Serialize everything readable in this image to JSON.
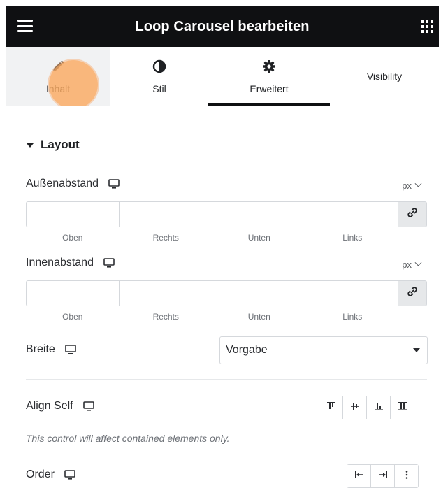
{
  "header": {
    "title": "Loop Carousel bearbeiten",
    "menu_icon": "hamburger-icon",
    "apps_icon": "grid-icon"
  },
  "tabs": [
    {
      "id": "content",
      "label": "Inhalt",
      "icon": "pencil-icon"
    },
    {
      "id": "style",
      "label": "Stil",
      "icon": "half-circle-icon"
    },
    {
      "id": "advanced",
      "label": "Erweitert",
      "icon": "gear-icon",
      "active": true
    },
    {
      "id": "visibility",
      "label": "Visibility"
    }
  ],
  "section": {
    "title": "Layout"
  },
  "margin": {
    "label": "Außenabstand",
    "unit": "px",
    "fields": [
      "",
      "",
      "",
      ""
    ],
    "sublabels": [
      "Oben",
      "Rechts",
      "Unten",
      "Links"
    ]
  },
  "padding": {
    "label": "Innenabstand",
    "unit": "px",
    "fields": [
      "",
      "",
      "",
      ""
    ],
    "sublabels": [
      "Oben",
      "Rechts",
      "Unten",
      "Links"
    ]
  },
  "width": {
    "label": "Breite",
    "value": "Vorgabe"
  },
  "align_self": {
    "label": "Align Self",
    "options": [
      "align-start-icon",
      "align-center-icon",
      "align-end-icon",
      "align-stretch-icon"
    ]
  },
  "note": "This control will affect contained elements only.",
  "order": {
    "label": "Order",
    "options": [
      "order-start-icon",
      "order-end-icon",
      "more-icon"
    ]
  },
  "colors": {
    "header_bg": "#0f1012",
    "active_tab_bg": "#f1f2f3",
    "touch": "#fba65a"
  }
}
